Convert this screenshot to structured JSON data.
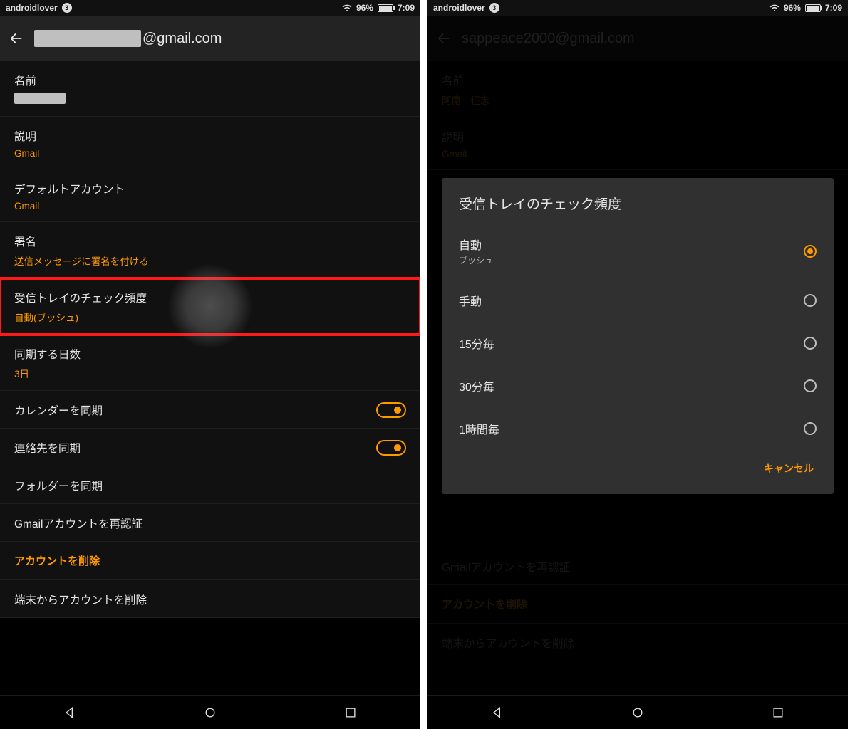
{
  "status": {
    "carrier": "androidlover",
    "notif_count": "3",
    "battery_pct": "96%",
    "time": "7:09"
  },
  "left": {
    "header_email_suffix": "@gmail.com",
    "items": {
      "name": {
        "title": "名前"
      },
      "desc": {
        "title": "説明",
        "sub": "Gmail"
      },
      "default_acct": {
        "title": "デフォルトアカウント",
        "sub": "Gmail"
      },
      "signature": {
        "title": "署名",
        "sub": "送信メッセージに署名を付ける"
      },
      "inbox_freq": {
        "title": "受信トレイのチェック頻度",
        "sub": "自動(プッシュ)"
      },
      "sync_days": {
        "title": "同期する日数",
        "sub": "3日"
      },
      "sync_cal": {
        "title": "カレンダーを同期"
      },
      "sync_contacts": {
        "title": "連絡先を同期"
      },
      "sync_folders": {
        "title": "フォルダーを同期"
      },
      "reauth": {
        "title": "Gmailアカウントを再認証"
      },
      "delete_section": "アカウントを削除",
      "delete_device": {
        "title": "端末からアカウントを削除"
      }
    }
  },
  "right": {
    "header_email": "sappeace2000@gmail.com",
    "items": {
      "name": {
        "title": "名前",
        "sub": "阿南　征志"
      },
      "desc": {
        "title": "説明",
        "sub": "Gmail"
      },
      "reauth": {
        "title": "Gmailアカウントを再認証"
      },
      "delete_section": "アカウントを削除",
      "delete_device": {
        "title": "端末からアカウントを削除"
      }
    }
  },
  "dialog": {
    "title": "受信トレイのチェック頻度",
    "options": {
      "auto": {
        "label": "自動",
        "sub": "プッシュ"
      },
      "manual": {
        "label": "手動"
      },
      "m15": {
        "label": "15分毎"
      },
      "m30": {
        "label": "30分毎"
      },
      "h1": {
        "label": "1時間毎"
      }
    },
    "cancel": "キャンセル"
  }
}
